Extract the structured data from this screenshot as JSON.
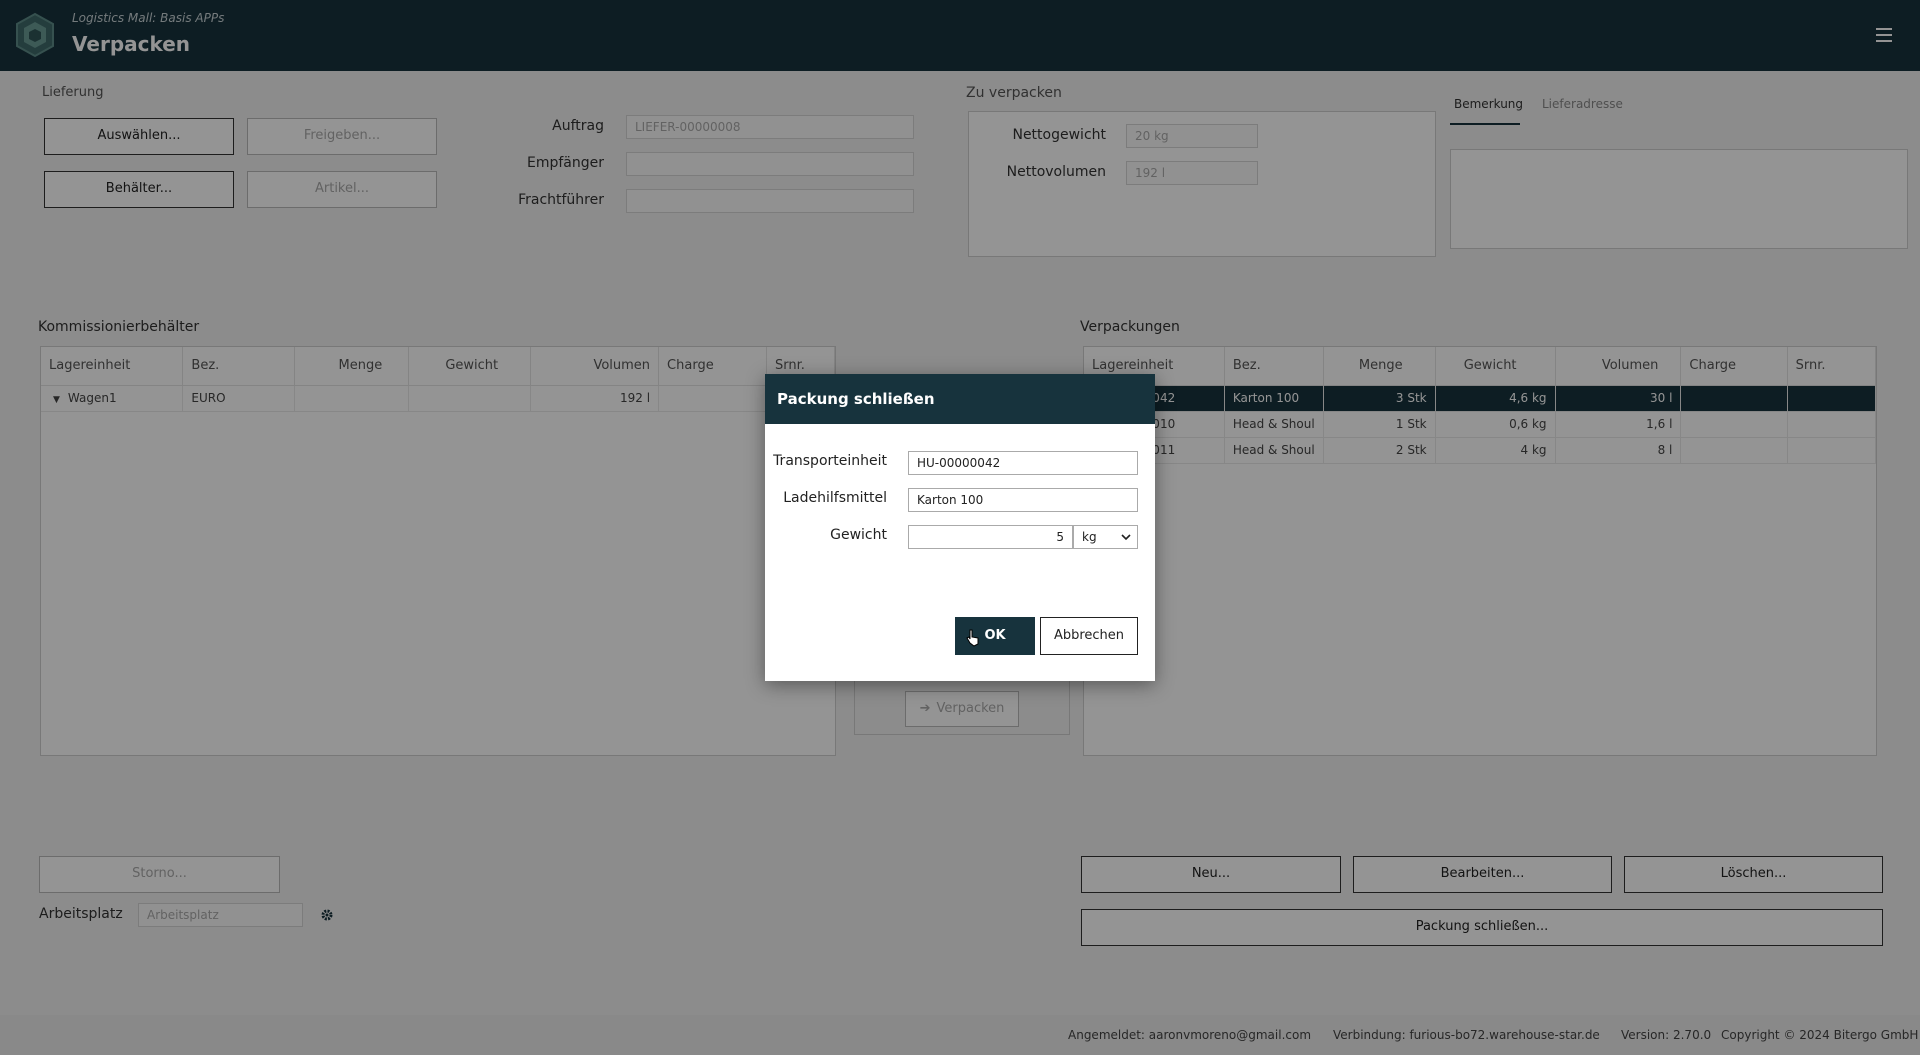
{
  "header": {
    "subtitle": "Logistics Mall: Basis APPs",
    "title": "Verpacken"
  },
  "lieferung": {
    "label": "Lieferung",
    "btn_auswaehlen": "Auswählen...",
    "btn_freigeben": "Freigeben...",
    "btn_behaelter": "Behälter...",
    "btn_artikel": "Artikel...",
    "auftrag_label": "Auftrag",
    "auftrag_value": "LIEFER-00000008",
    "empfaenger_label": "Empfänger",
    "frachtfuehrer_label": "Frachtführer"
  },
  "zu_verpacken": {
    "label": "Zu verpacken",
    "nettogewicht_label": "Nettogewicht",
    "nettogewicht_value": "20 kg",
    "nettovolumen_label": "Nettovolumen",
    "nettovolumen_value": "192 l"
  },
  "tabs": {
    "bemerkung": "Bemerkung",
    "lieferadresse": "Lieferadresse"
  },
  "kommissionier": {
    "title": "Kommissionierbehälter",
    "columns": [
      "Lagereinheit",
      "Bez.",
      "Menge",
      "Gewicht",
      "Volumen",
      "Charge",
      "Srnr."
    ],
    "rows": [
      {
        "lagereinheit": "Wagen1",
        "bez": "EURO",
        "menge": "",
        "gewicht": "",
        "volumen": "192 l",
        "charge": "",
        "srnr": ""
      }
    ],
    "btn_storno": "Storno...",
    "arbeitsplatz_label": "Arbeitsplatz",
    "arbeitsplatz_placeholder": "Arbeitsplatz"
  },
  "middle": {
    "btn_verpacken": "Verpacken"
  },
  "verpackungen": {
    "title": "Verpackungen",
    "columns": [
      "Lagereinheit",
      "Bez.",
      "Menge",
      "Gewicht",
      "Volumen",
      "Charge",
      "Srnr."
    ],
    "rows": [
      {
        "lagereinheit": "HU-00000042",
        "bez": "Karton 100",
        "menge": "3 Stk",
        "gewicht": "4,6 kg",
        "volumen": "30 l",
        "charge": "",
        "srnr": ""
      },
      {
        "lagereinheit": "HU-00000010",
        "bez": "Head & Shoul",
        "menge": "1 Stk",
        "gewicht": "0,6 kg",
        "volumen": "1,6 l",
        "charge": "",
        "srnr": ""
      },
      {
        "lagereinheit": "HU-00000011",
        "bez": "Head & Shoul",
        "menge": "2 Stk",
        "gewicht": "4 kg",
        "volumen": "8 l",
        "charge": "",
        "srnr": ""
      }
    ],
    "btn_neu": "Neu...",
    "btn_bearbeiten": "Bearbeiten...",
    "btn_loeschen": "Löschen...",
    "btn_packung_schliessen": "Packung schließen..."
  },
  "footer": {
    "user": "Angemeldet: aaronvmoreno@gmail.com",
    "connection": "Verbindung: furious-bo72.warehouse-star.de",
    "version": "Version: 2.70.0",
    "copyright": "Copyright © 2024 Bitergo GmbH"
  },
  "dialog": {
    "title": "Packung schließen",
    "transporteinheit_label": "Transporteinheit",
    "transporteinheit_value": "HU-00000042",
    "ladehilfsmittel_label": "Ladehilfsmittel",
    "ladehilfsmittel_value": "Karton 100",
    "gewicht_label": "Gewicht",
    "gewicht_value": "5",
    "gewicht_unit": "kg",
    "btn_ok": "OK",
    "btn_abbrechen": "Abbrechen"
  },
  "colors": {
    "header_bg": "#17333d",
    "accent": "#17333d"
  }
}
